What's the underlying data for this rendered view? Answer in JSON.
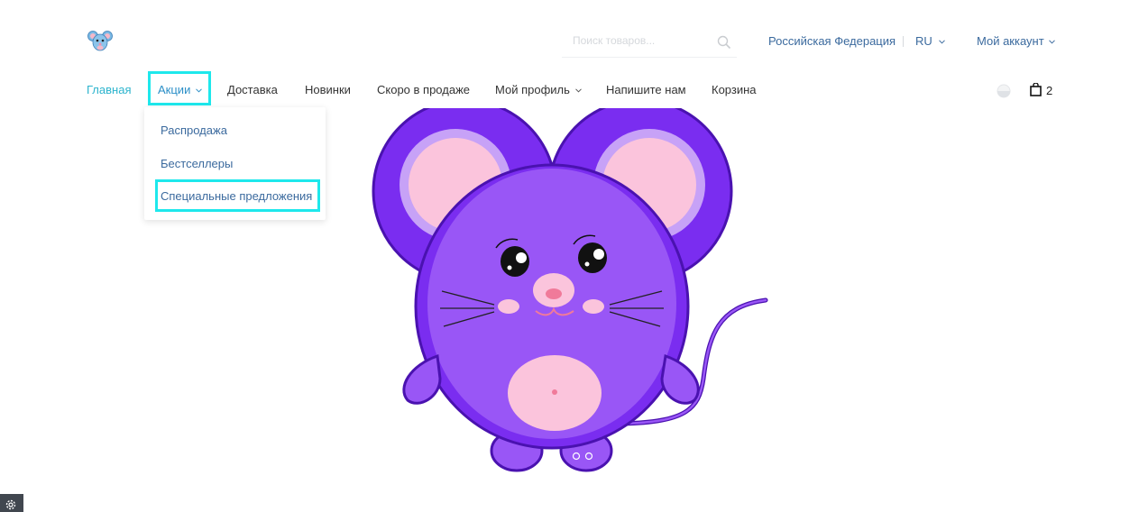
{
  "header": {
    "search": {
      "placeholder": "Поиск товаров...",
      "value": ""
    },
    "region_label": "Российская Федерация",
    "language_label": "RU",
    "account_label": "Мой аккаунт"
  },
  "nav": {
    "items": [
      {
        "label": "Главная"
      },
      {
        "label": "Акции"
      },
      {
        "label": "Доставка"
      },
      {
        "label": "Новинки"
      },
      {
        "label": "Скоро в продаже"
      },
      {
        "label": "Мой профиль"
      },
      {
        "label": "Напишите нам"
      },
      {
        "label": "Корзина"
      }
    ],
    "dropdown": [
      {
        "label": "Распродажа"
      },
      {
        "label": "Бестселлеры"
      },
      {
        "label": "Специальные предложения"
      }
    ]
  },
  "cart": {
    "count": "2"
  },
  "colors": {
    "accent_cyan": "#2cb4cd",
    "link_blue": "#3b6a9e",
    "highlight": "#1ee8ec",
    "mouse_purple": "#9956f6"
  },
  "icons": [
    "search-icon",
    "chevron-down-icon",
    "half-circle-icon",
    "shopping-bag-icon",
    "gear-icon"
  ],
  "hero": {
    "slides_total": 2,
    "active_slide": 1
  }
}
